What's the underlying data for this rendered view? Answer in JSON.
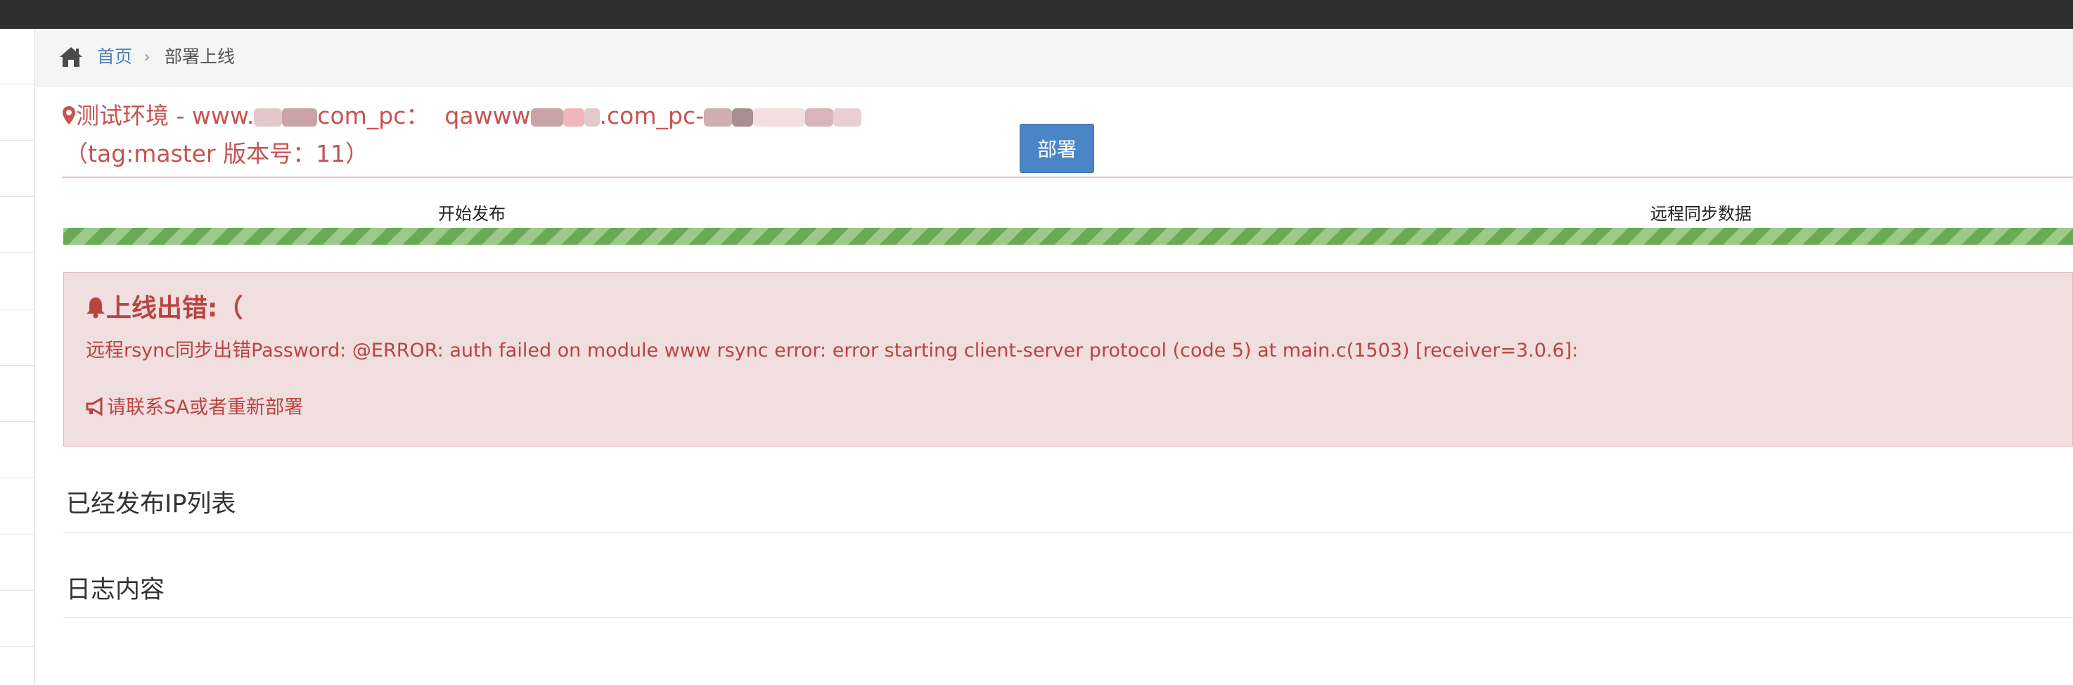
{
  "breadcrumb": {
    "home_icon": "home-icon",
    "home": "首页",
    "separator": "›",
    "current": "部署上线"
  },
  "environment": {
    "pin_icon": "map-marker-icon",
    "prefix": "测试环境 - www.",
    "mid1": "com_pc：",
    "mid2": "qawww",
    "mid3": ".com_pc-",
    "tag_line": "（tag:master 版本号：11）"
  },
  "deploy_button": "部署",
  "progress": {
    "steps": [
      "开始发布",
      "远程同步数据"
    ],
    "percent": 100,
    "colors": {
      "stripe_dark": "#6aaa54",
      "stripe_light": "#9bca88"
    }
  },
  "alert": {
    "bell_icon": "bell-icon",
    "title": "上线出错:（",
    "message": "远程rsync同步出错Password: @ERROR: auth failed on module www rsync error: error starting client-server protocol (code 5) at main.c(1503) [receiver=3.0.6]:",
    "megaphone_icon": "megaphone-icon",
    "contact": "请联系SA或者重新部署",
    "colors": {
      "background": "#f1dede",
      "text": "#b84442"
    }
  },
  "sections": {
    "ip_list_title": "已经发布IP列表",
    "log_title": "日志内容"
  }
}
